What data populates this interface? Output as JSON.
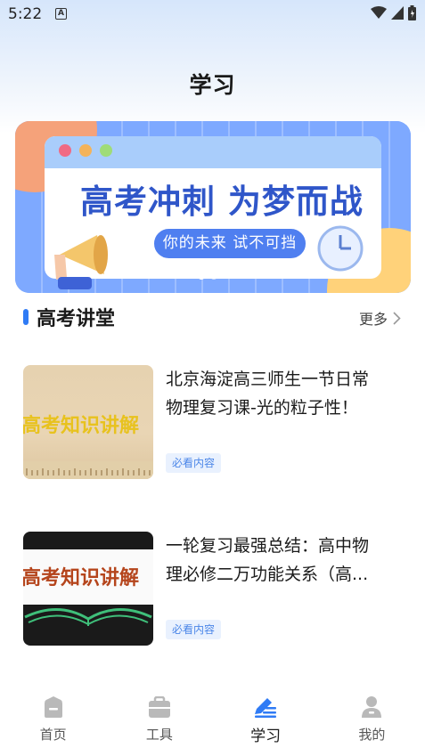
{
  "status_bar": {
    "time": "5:22",
    "notification_badge": "A"
  },
  "header": {
    "title": "学习"
  },
  "banner": {
    "headline": "高考冲刺 为梦而战",
    "subline": "你的未来 试不可挡",
    "slide_count": 2,
    "active_slide": 1
  },
  "section": {
    "title": "高考讲堂",
    "more_label": "更多"
  },
  "items": [
    {
      "thumb_text": "高考知识讲解",
      "title_lines": [
        "北京海淀高三师生一节日常",
        "物理复习课-光的粒子性！"
      ],
      "tag": "必看内容"
    },
    {
      "thumb_text": "高考知识讲解",
      "title_lines": [
        "一轮复习最强总结：高中物",
        "理必修二万功能关系（高..."
      ],
      "tag": "必看内容"
    }
  ],
  "nav": [
    {
      "label": "首页",
      "icon": "home-icon",
      "active": false
    },
    {
      "label": "工具",
      "icon": "toolbox-icon",
      "active": false
    },
    {
      "label": "学习",
      "icon": "study-pen-icon",
      "active": true
    },
    {
      "label": "我的",
      "icon": "profile-icon",
      "active": false
    }
  ],
  "colors": {
    "accent": "#2f7bf5",
    "banner_bg": "#7aa8ff",
    "tag_text": "#4b86e8"
  }
}
